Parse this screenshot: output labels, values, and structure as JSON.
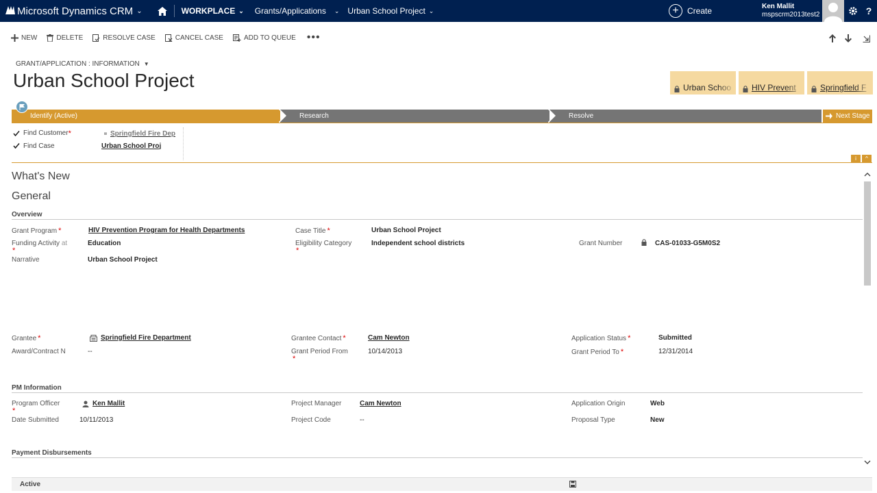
{
  "nav": {
    "app_name": "Microsoft Dynamics CRM",
    "workplace": "WORKPLACE",
    "area": "Grants/Applications",
    "record": "Urban School Project",
    "create": "Create",
    "user_name": "Ken Mallit",
    "org_name": "mspscrm2013test2",
    "help": "?"
  },
  "commands": {
    "new": "NEW",
    "delete": "DELETE",
    "resolve_case": "RESOLVE CASE",
    "cancel_case": "CANCEL CASE",
    "add_to_queue": "ADD TO QUEUE",
    "more": "•••"
  },
  "header": {
    "entity_form": "GRANT/APPLICATION : INFORMATION",
    "title": "Urban School Project",
    "tiles": [
      {
        "label": "Urban Schoo"
      },
      {
        "label": "HIV Prevent"
      },
      {
        "label": "Springfield F"
      }
    ]
  },
  "process": {
    "stages": [
      {
        "label": "Identify (Active)"
      },
      {
        "label": "Research"
      },
      {
        "label": "Resolve"
      }
    ],
    "next_stage": "Next Stage",
    "steps": [
      {
        "label": "Find Customer",
        "value": "Springfield Fire Dep"
      },
      {
        "label": "Find Case",
        "value": "Urban School Proj"
      }
    ],
    "info": "i",
    "collapse": "^"
  },
  "sections": {
    "whats_new": "What's New",
    "general": "General",
    "overview": "Overview",
    "pm_information": "PM Information",
    "payment_disbursements": "Payment Disbursements"
  },
  "fields": {
    "grant_program": {
      "label": "Grant Program",
      "value": "HIV Prevention Program for Health Departments"
    },
    "case_title": {
      "label": "Case Title",
      "value": "Urban School Project"
    },
    "funding_activity": {
      "label": "Funding Activity",
      "suffix": "at",
      "value": "Education"
    },
    "eligibility_category": {
      "label": "Eligibility Category",
      "value": "Independent school districts"
    },
    "grant_number": {
      "label": "Grant Number",
      "value": "CAS-01033-G5M0S2"
    },
    "narrative": {
      "label": "Narrative",
      "value": "Urban School Project"
    },
    "grantee": {
      "label": "Grantee",
      "value": "Springfield Fire Department"
    },
    "grantee_contact": {
      "label": "Grantee Contact",
      "value": "Cam Newton"
    },
    "application_status": {
      "label": "Application Status",
      "value": "Submitted"
    },
    "award_contract": {
      "label": "Award/Contract N",
      "value": "--"
    },
    "grant_period_from": {
      "label": "Grant Period From",
      "value": "10/14/2013"
    },
    "grant_period_to": {
      "label": "Grant Period To",
      "value": "12/31/2014"
    },
    "program_officer": {
      "label": "Program Officer",
      "value": "Ken Mallit"
    },
    "project_manager": {
      "label": "Project Manager",
      "value": "Cam Newton"
    },
    "application_origin": {
      "label": "Application Origin",
      "value": "Web"
    },
    "date_submitted": {
      "label": "Date Submitted",
      "value": "10/11/2013"
    },
    "project_code": {
      "label": "Project Code",
      "value": "--"
    },
    "proposal_type": {
      "label": "Proposal Type",
      "value": "New"
    }
  },
  "footer": {
    "status": "Active"
  },
  "colors": {
    "nav": "#002050",
    "accent": "#d6992f",
    "stage_inactive": "#757575",
    "tile": "#f5d9a0",
    "required": "#dd0000"
  }
}
